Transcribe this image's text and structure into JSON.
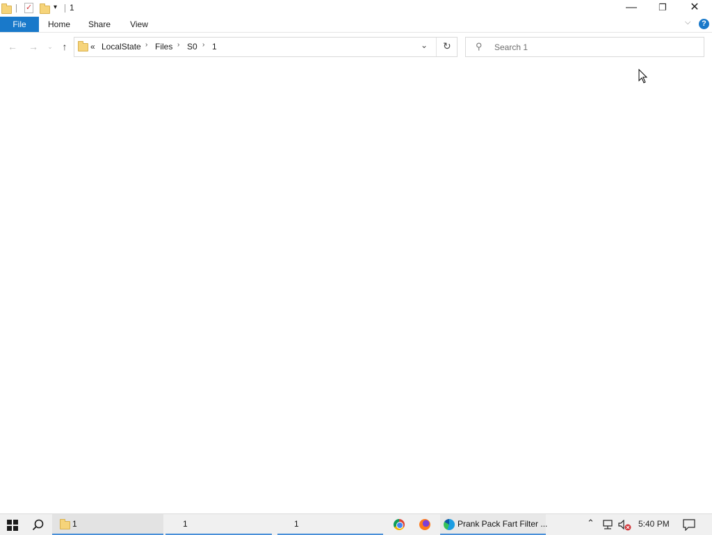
{
  "window": {
    "title": "1",
    "minimize": "—",
    "restore": "❐",
    "close": "✕"
  },
  "ribbon": {
    "tabs": [
      "File",
      "Home",
      "Share",
      "View"
    ],
    "help": "?"
  },
  "address": {
    "overflow": "«",
    "breadcrumbs": [
      "LocalState",
      "Files",
      "S0",
      "1"
    ]
  },
  "search": {
    "placeholder": "Search 1"
  },
  "taskbar": {
    "items": [
      {
        "label": "1"
      },
      {
        "label": "1"
      },
      {
        "label": "1"
      },
      {
        "label": "Prank Pack Fart Filter ..."
      }
    ],
    "clock": "5:40 PM"
  },
  "colors": {
    "accent": "#1979ca",
    "taskbar": "#f0f0f0",
    "folder": "#f6d47a"
  }
}
